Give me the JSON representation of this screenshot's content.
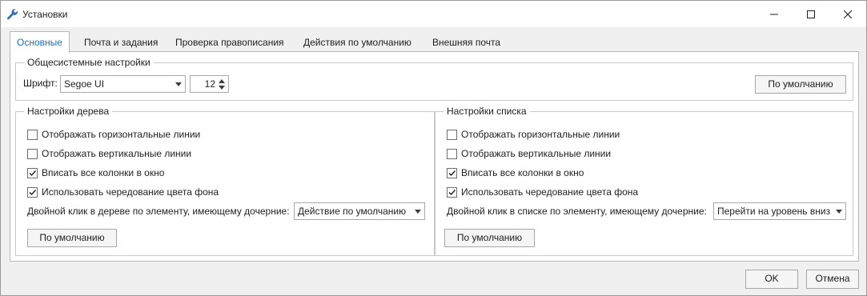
{
  "window": {
    "title": "Установки",
    "icon": "wrench-icon"
  },
  "tabs": [
    {
      "label": "Основные",
      "active": true
    },
    {
      "label": "Почта и задания",
      "active": false
    },
    {
      "label": "Проверка правописания",
      "active": false
    },
    {
      "label": "Действия по умолчанию",
      "active": false
    },
    {
      "label": "Внешняя почта",
      "active": false
    }
  ],
  "system": {
    "title": "Общесистемные настройки",
    "font_label": "Шрифт:",
    "font_value": "Segoe UI",
    "size_value": "12",
    "default_button": "По умолчанию"
  },
  "tree": {
    "title": "Настройки дерева",
    "options": [
      {
        "label": "Отображать горизонтальные линии",
        "checked": false
      },
      {
        "label": "Отображать вертикальные линии",
        "checked": false
      },
      {
        "label": "Вписать все колонки в окно",
        "checked": true
      },
      {
        "label": "Использовать чередование цвета фона",
        "checked": true
      }
    ],
    "dblclick_label": "Двойной клик в дереве по элементу, имеющему дочерние:",
    "dblclick_value": "Действие по умолчанию",
    "default_button": "По умолчанию"
  },
  "list": {
    "title": "Настройки списка",
    "options": [
      {
        "label": "Отображать горизонтальные линии",
        "checked": false
      },
      {
        "label": "Отображать вертикальные линии",
        "checked": false
      },
      {
        "label": "Вписать все колонки в окно",
        "checked": true
      },
      {
        "label": "Использовать чередование цвета фона",
        "checked": true
      }
    ],
    "dblclick_label": "Двойной клик в списке по элементу, имеющему дочерние:",
    "dblclick_value": "Перейти на уровень вниз",
    "default_button": "По умолчанию"
  },
  "footer": {
    "ok": "OK",
    "cancel": "Отмена"
  },
  "colors": {
    "accent": "#1a6fc1",
    "window_bg": "#f0f0f0",
    "panel_bg": "#ffffff"
  }
}
